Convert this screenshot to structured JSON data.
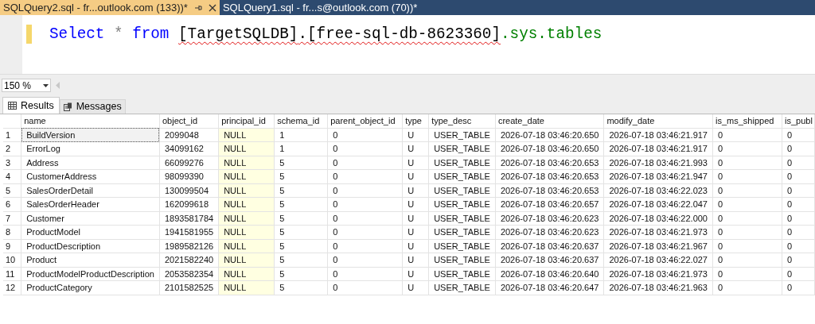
{
  "tabs": [
    {
      "label": "SQLQuery2.sql - fr...outlook.com (133))*",
      "selected": true
    },
    {
      "label": "SQLQuery1.sql - fr...s@outlook.com (70))*",
      "selected": false
    }
  ],
  "editor": {
    "tokens": [
      {
        "text": "Select ",
        "kind": "keyword"
      },
      {
        "text": "* ",
        "kind": "operator"
      },
      {
        "text": "from ",
        "kind": "keyword"
      },
      {
        "text": "[TargetSQLDB]",
        "kind": "identifier"
      },
      {
        "text": ".[free-sql-db-8623360]",
        "kind": "identifier"
      },
      {
        "text": ".sys.tables",
        "kind": "system"
      }
    ]
  },
  "zoom": "150 %",
  "result_tabs": [
    {
      "label": "Results",
      "selected": true
    },
    {
      "label": "Messages",
      "selected": false
    }
  ],
  "table": {
    "columns": [
      {
        "label": "name",
        "highlighted": false
      },
      {
        "label": "object_id",
        "highlighted": false
      },
      {
        "label": "principal_id",
        "highlighted": true
      },
      {
        "label": "schema_id",
        "highlighted": false
      },
      {
        "label": "parent_object_id",
        "highlighted": false
      },
      {
        "label": "type",
        "highlighted": false
      },
      {
        "label": "type_desc",
        "highlighted": false
      },
      {
        "label": "create_date",
        "highlighted": false
      },
      {
        "label": "modify_date",
        "highlighted": false
      },
      {
        "label": "is_ms_shipped",
        "highlighted": false
      },
      {
        "label": "is_publ",
        "highlighted": false
      }
    ],
    "rows": [
      {
        "number": "1",
        "focused": true,
        "cells": [
          "BuildVersion",
          "2099048",
          "NULL",
          "1",
          "0",
          "U",
          "USER_TABLE",
          "2026-07-18 03:46:20.650",
          "2026-07-18 03:46:21.917",
          "0",
          "0"
        ]
      },
      {
        "number": "2",
        "focused": false,
        "cells": [
          "ErrorLog",
          "34099162",
          "NULL",
          "1",
          "0",
          "U",
          "USER_TABLE",
          "2026-07-18 03:46:20.650",
          "2026-07-18 03:46:21.917",
          "0",
          "0"
        ]
      },
      {
        "number": "3",
        "focused": false,
        "cells": [
          "Address",
          "66099276",
          "NULL",
          "5",
          "0",
          "U",
          "USER_TABLE",
          "2026-07-18 03:46:20.653",
          "2026-07-18 03:46:21.993",
          "0",
          "0"
        ]
      },
      {
        "number": "4",
        "focused": false,
        "cells": [
          "CustomerAddress",
          "98099390",
          "NULL",
          "5",
          "0",
          "U",
          "USER_TABLE",
          "2026-07-18 03:46:20.653",
          "2026-07-18 03:46:21.947",
          "0",
          "0"
        ]
      },
      {
        "number": "5",
        "focused": false,
        "cells": [
          "SalesOrderDetail",
          "130099504",
          "NULL",
          "5",
          "0",
          "U",
          "USER_TABLE",
          "2026-07-18 03:46:20.653",
          "2026-07-18 03:46:22.023",
          "0",
          "0"
        ]
      },
      {
        "number": "6",
        "focused": false,
        "cells": [
          "SalesOrderHeader",
          "162099618",
          "NULL",
          "5",
          "0",
          "U",
          "USER_TABLE",
          "2026-07-18 03:46:20.657",
          "2026-07-18 03:46:22.047",
          "0",
          "0"
        ]
      },
      {
        "number": "7",
        "focused": false,
        "cells": [
          "Customer",
          "1893581784",
          "NULL",
          "5",
          "0",
          "U",
          "USER_TABLE",
          "2026-07-18 03:46:20.623",
          "2026-07-18 03:46:22.000",
          "0",
          "0"
        ]
      },
      {
        "number": "8",
        "focused": false,
        "cells": [
          "ProductModel",
          "1941581955",
          "NULL",
          "5",
          "0",
          "U",
          "USER_TABLE",
          "2026-07-18 03:46:20.623",
          "2026-07-18 03:46:21.973",
          "0",
          "0"
        ]
      },
      {
        "number": "9",
        "focused": false,
        "cells": [
          "ProductDescription",
          "1989582126",
          "NULL",
          "5",
          "0",
          "U",
          "USER_TABLE",
          "2026-07-18 03:46:20.637",
          "2026-07-18 03:46:21.967",
          "0",
          "0"
        ]
      },
      {
        "number": "10",
        "focused": false,
        "cells": [
          "Product",
          "2021582240",
          "NULL",
          "5",
          "0",
          "U",
          "USER_TABLE",
          "2026-07-18 03:46:20.637",
          "2026-07-18 03:46:22.027",
          "0",
          "0"
        ]
      },
      {
        "number": "11",
        "focused": false,
        "cells": [
          "ProductModelProductDescription",
          "2053582354",
          "NULL",
          "5",
          "0",
          "U",
          "USER_TABLE",
          "2026-07-18 03:46:20.640",
          "2026-07-18 03:46:21.973",
          "0",
          "0"
        ]
      },
      {
        "number": "12",
        "focused": false,
        "cells": [
          "ProductCategory",
          "2101582525",
          "NULL",
          "5",
          "0",
          "U",
          "USER_TABLE",
          "2026-07-18 03:46:20.647",
          "2026-07-18 03:46:21.963",
          "0",
          "0"
        ]
      }
    ]
  }
}
